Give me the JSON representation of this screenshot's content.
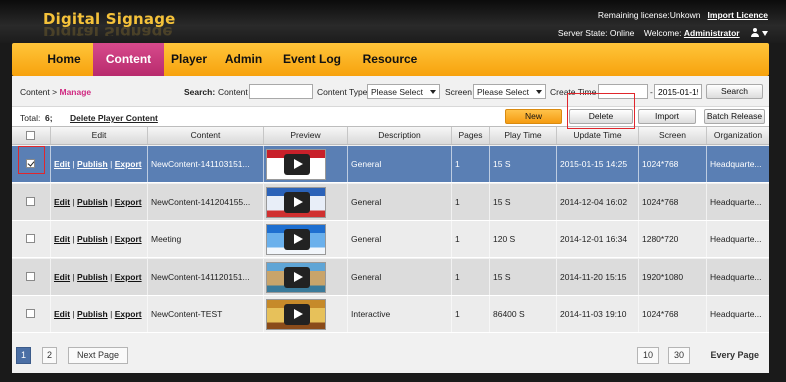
{
  "header": {
    "brand": "Digital Signage",
    "license_text": "Remaining license:Unkown",
    "import_licence": "Import Licence",
    "server_state": "Server State: Online",
    "welcome": "Welcome:",
    "user": "Administrator"
  },
  "nav": {
    "items": [
      "Home",
      "Content",
      "Player",
      "Admin",
      "Event Log",
      "Resource"
    ],
    "active": "Content"
  },
  "search": {
    "breadcrumb_root": "Content >",
    "breadcrumb_page": "Manage",
    "search_label": "Search:",
    "content_label": "Content",
    "content_value": "",
    "content_type_label": "Content Type",
    "content_type_value": "Please Select",
    "screen_label": "Screen",
    "screen_value": "Please Select",
    "create_time_label": "Create Time",
    "create_time_from": "",
    "dash": "-",
    "create_time_to": "2015-01-15",
    "search_button": "Search"
  },
  "toolbar": {
    "total_label": "Total:",
    "total_value": "6;",
    "delete_player_content": "Delete Player Content",
    "new_button": "New",
    "delete_button": "Delete",
    "import_button": "Import",
    "batch_release_button": "Batch Release"
  },
  "table": {
    "columns": [
      "Edit",
      "Content",
      "Preview",
      "Description",
      "Pages",
      "Play Time",
      "Update Time",
      "Screen",
      "Organization"
    ],
    "actions": {
      "edit": "Edit",
      "publish": "Publish",
      "export": "Export",
      "sep": "|"
    },
    "rows": [
      {
        "checked": true,
        "content": "NewContent-141103151...",
        "description": "General",
        "pages": "1",
        "play_time": "15 S",
        "update_time": "2015-01-15 14:25",
        "screen": "1024*768",
        "organization": "Headquarte...",
        "thumb_colors": [
          "#c8202a",
          "#ffffff",
          "#ffffff"
        ]
      },
      {
        "checked": false,
        "content": "NewContent-141204155...",
        "description": "General",
        "pages": "1",
        "play_time": "15 S",
        "update_time": "2014-12-04 16:02",
        "screen": "1024*768",
        "organization": "Headquarte...",
        "thumb_colors": [
          "#2b62b8",
          "#e8eef8",
          "#d03030"
        ]
      },
      {
        "checked": false,
        "content": "Meeting",
        "description": "General",
        "pages": "1",
        "play_time": "120 S",
        "update_time": "2014-12-01 16:34",
        "screen": "1280*720",
        "organization": "Headquarte...",
        "thumb_colors": [
          "#1e6fd0",
          "#6ab0ec",
          "#f2f6fb"
        ]
      },
      {
        "checked": false,
        "content": "NewContent-141120151...",
        "description": "General",
        "pages": "1",
        "play_time": "15 S",
        "update_time": "2014-11-20 15:15",
        "screen": "1920*1080",
        "organization": "Headquarte...",
        "thumb_colors": [
          "#5fa5d6",
          "#c9a46a",
          "#3a7a9a"
        ]
      },
      {
        "checked": false,
        "content": "NewContent-TEST",
        "description": "Interactive",
        "pages": "1",
        "play_time": "86400 S",
        "update_time": "2014-11-03 19:10",
        "screen": "1024*768",
        "organization": "Headquarte...",
        "thumb_colors": [
          "#c68a2a",
          "#e7c15a",
          "#8a4b1a"
        ]
      }
    ]
  },
  "pager": {
    "pages": [
      "1",
      "2"
    ],
    "current": "1",
    "next_page": "Next Page",
    "sizes": [
      "10",
      "30"
    ],
    "every_page": "Every Page"
  }
}
